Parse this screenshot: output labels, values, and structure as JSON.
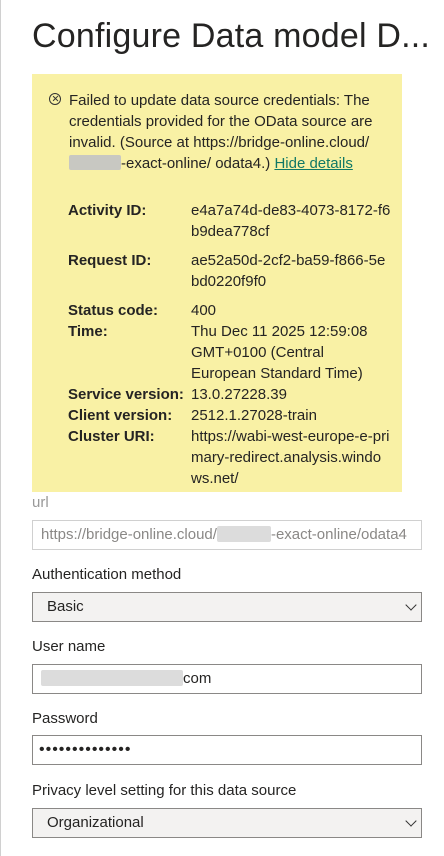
{
  "dialog": {
    "title": "Configure Data model D..."
  },
  "error": {
    "message_part1": "Failed to update data source credentials: The credentials provided for the OData source are invalid. (Source at https://bridge-online.cloud/",
    "message_part2": "-exact-online/ odata4.)",
    "hide_details": "Hide details",
    "details": [
      {
        "label": "Activity ID:",
        "value": "e4a7a74d-de83-4073-8172-f6b9dea778cf"
      },
      {
        "label": "Request ID:",
        "value": "ae52a50d-2cf2-ba59-f866-5ebd0220f9f0"
      },
      {
        "label": "Status code:",
        "value": "400"
      },
      {
        "label": "Time:",
        "value": "Thu Dec 11 2025 12:59:08 GMT+0100 (Central European Standard Time)"
      },
      {
        "label": "Service version:",
        "value": "13.0.27228.39"
      },
      {
        "label": "Client version:",
        "value": "2512.1.27028-train"
      },
      {
        "label": "Cluster URI:",
        "value": "https://wabi-west-europe-e-primary-redirect.analysis.windows.net/"
      }
    ]
  },
  "form": {
    "url_label": "url",
    "url_prefix": "https://bridge-online.cloud/",
    "url_suffix": "-exact-online/odata4",
    "auth_label": "Authentication method",
    "auth_value": "Basic",
    "username_label": "User name",
    "username_suffix": "com",
    "password_label": "Password",
    "password_value": "••••••••••••••",
    "privacy_label": "Privacy level setting for this data source",
    "privacy_value": "Organizational"
  }
}
